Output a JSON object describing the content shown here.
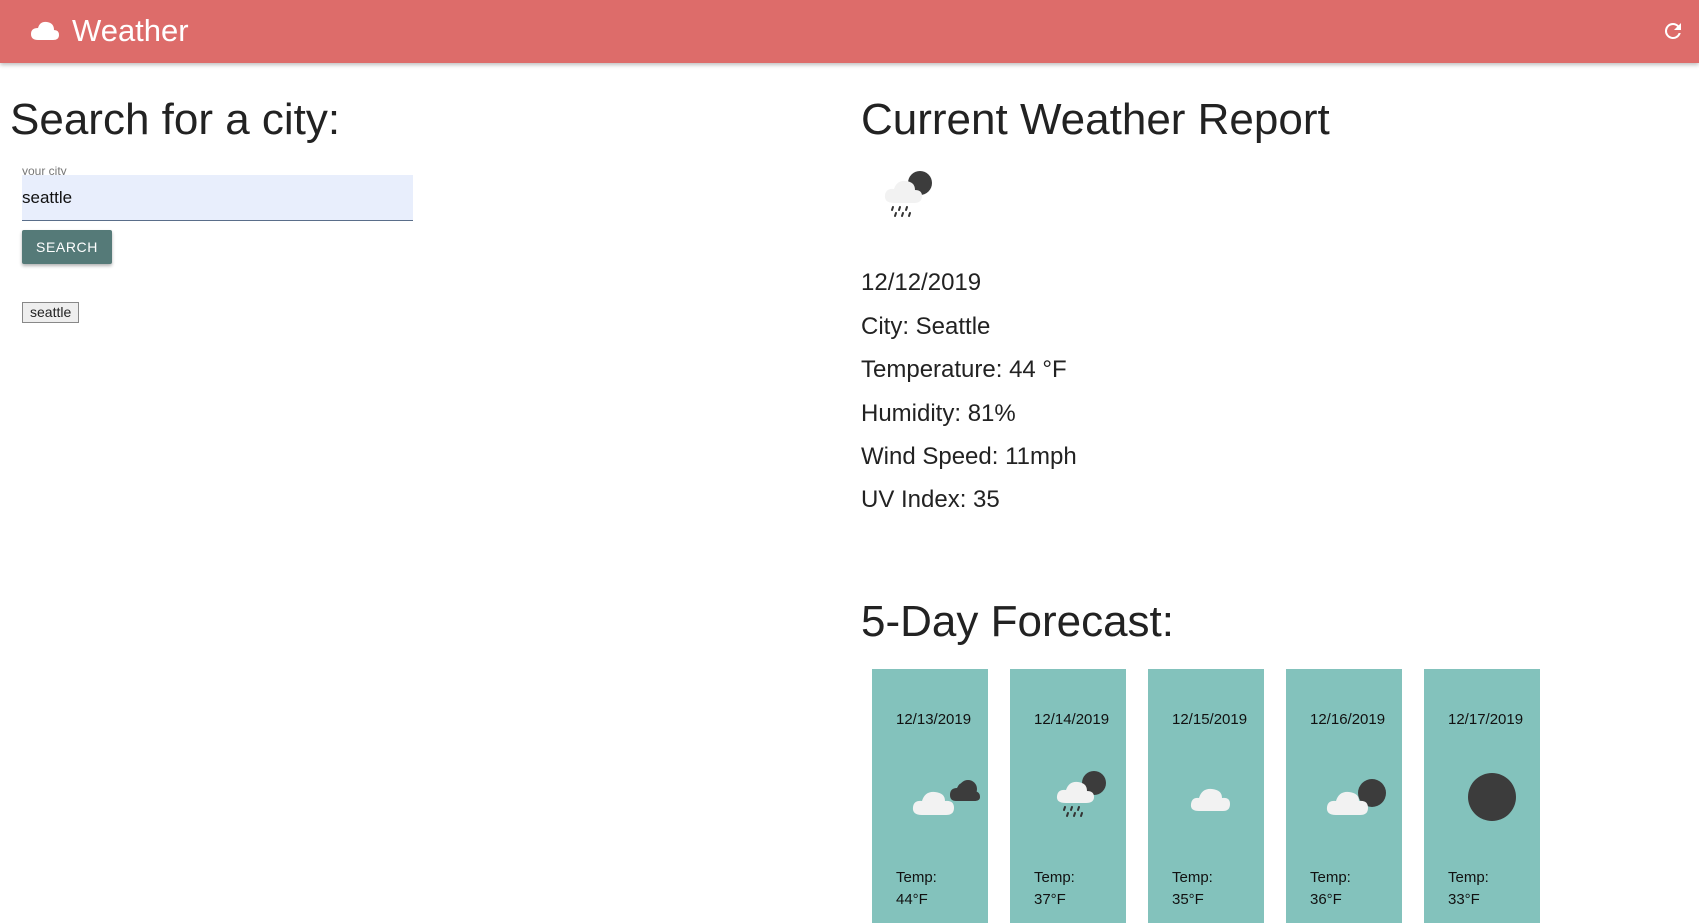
{
  "header": {
    "title": "Weather",
    "logo_icon": "cloud-icon",
    "refresh_icon": "refresh-icon",
    "bar_color": "#dd6c6a"
  },
  "search": {
    "heading": "Search for a city:",
    "field_label": "your city",
    "input_value": "seattle",
    "button_label": "SEARCH",
    "button_color": "#557a78",
    "history": [
      "seattle"
    ]
  },
  "current": {
    "heading": "Current Weather Report",
    "icon": "night-rain-icon",
    "date": "12/12/2019",
    "city": "City: Seattle",
    "temperature": "Temperature: 44 °F",
    "humidity": "Humidity: 81%",
    "wind": "Wind Speed: 11mph",
    "uv": "UV Index: 35"
  },
  "forecast": {
    "heading": "5-Day Forecast:",
    "card_color": "#83c2bc",
    "days": [
      {
        "date": "12/13/2019",
        "icon": "night-broken-clouds-icon",
        "temp_label": "Temp:",
        "temp": "44°F"
      },
      {
        "date": "12/14/2019",
        "icon": "night-rain-icon",
        "temp_label": "Temp:",
        "temp": "37°F"
      },
      {
        "date": "12/15/2019",
        "icon": "cloud-icon",
        "temp_label": "Temp:",
        "temp": "35°F"
      },
      {
        "date": "12/16/2019",
        "icon": "night-clouds-icon",
        "temp_label": "Temp:",
        "temp": "36°F"
      },
      {
        "date": "12/17/2019",
        "icon": "clear-night-icon",
        "temp_label": "Temp:",
        "temp": "33°F"
      }
    ]
  }
}
